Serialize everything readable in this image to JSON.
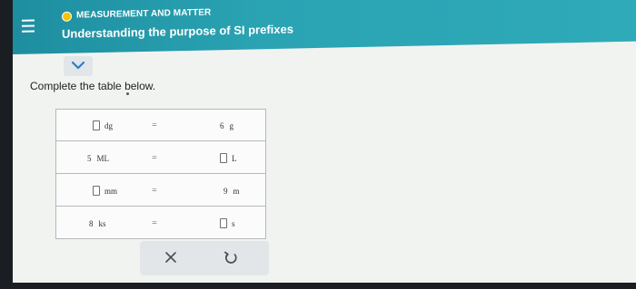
{
  "header": {
    "topic": "MEASUREMENT AND MATTER",
    "title": "Understanding the purpose of SI prefixes"
  },
  "instruction": "Complete the table below.",
  "table": {
    "rows": [
      {
        "left_value": "",
        "left_unit": "dg",
        "equals": "=",
        "right_value": "6",
        "right_unit": "g"
      },
      {
        "left_value": "5",
        "left_unit": "ML",
        "equals": "=",
        "right_value": "",
        "right_unit": "L"
      },
      {
        "left_value": "",
        "left_unit": "mm",
        "equals": "=",
        "right_value": "9",
        "right_unit": "m"
      },
      {
        "left_value": "8",
        "left_unit": "ks",
        "equals": "=",
        "right_value": "",
        "right_unit": "s"
      }
    ]
  },
  "colors": {
    "header_accent": "#2aa3b3",
    "topic_dot": "#f5c400"
  },
  "icons": [
    "menu-icon",
    "chevron-down-icon",
    "close-icon",
    "undo-icon"
  ]
}
